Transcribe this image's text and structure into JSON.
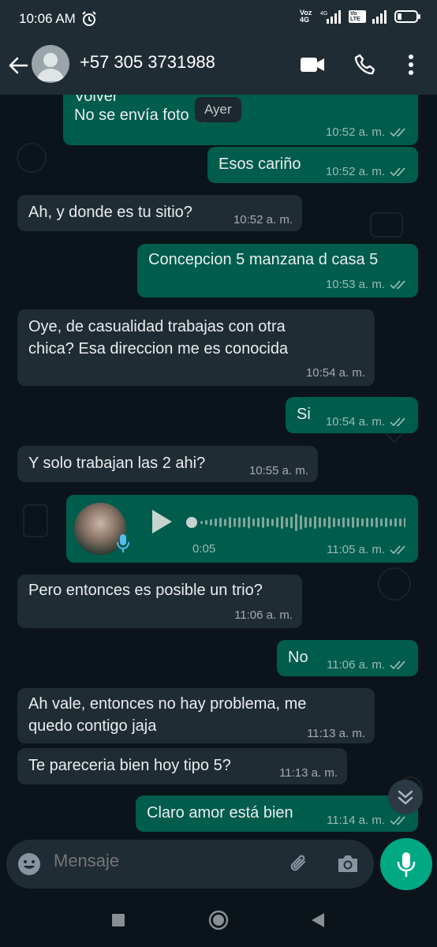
{
  "status": {
    "time": "10:06 AM",
    "net1": "Voz 4G",
    "net2": "4G",
    "volte": "Vo LTE"
  },
  "header": {
    "contact": "+57 305 3731988"
  },
  "date_chip": "Ayer",
  "messages": [
    {
      "dir": "out",
      "lines": [
        "Volver",
        "No se envía foto"
      ],
      "emoji": "😅",
      "time": "10:52 a. m.",
      "read": true
    },
    {
      "dir": "out",
      "lines": [
        "Esos cariño"
      ],
      "time": "10:52 a. m.",
      "read": true
    },
    {
      "dir": "in",
      "lines": [
        "Ah, y donde es tu sitio?"
      ],
      "time": "10:52 a. m."
    },
    {
      "dir": "out",
      "lines": [
        "Concepcion 5 manzana d casa 5"
      ],
      "time": "10:53 a. m.",
      "read": true
    },
    {
      "dir": "in",
      "lines": [
        "Oye, de casualidad trabajas con otra",
        "chica? Esa direccion me es conocida"
      ],
      "time": "10:54 a. m."
    },
    {
      "dir": "out",
      "lines": [
        "Si"
      ],
      "time": "10:54 a. m.",
      "read": true
    },
    {
      "dir": "in",
      "lines": [
        "Y solo trabajan las 2 ahi?"
      ],
      "time": "10:55 a. m."
    },
    {
      "dir": "out",
      "type": "voice",
      "duration": "0:05",
      "time": "11:05 a. m.",
      "read": true
    },
    {
      "dir": "in",
      "lines": [
        "Pero entonces es posible un trio?"
      ],
      "time": "11:06 a. m."
    },
    {
      "dir": "out",
      "lines": [
        "No"
      ],
      "time": "11:06 a. m.",
      "read": true
    },
    {
      "dir": "in",
      "lines": [
        "Ah vale, entonces no hay problema, me",
        "quedo contigo jaja"
      ],
      "time": "11:13 a. m."
    },
    {
      "dir": "in",
      "lines": [
        "Te pareceria bien hoy tipo 5?"
      ],
      "time": "11:13 a. m."
    },
    {
      "dir": "out",
      "lines": [
        "Claro amor está bien"
      ],
      "time": "11:14 a. m.",
      "read": true
    }
  ],
  "input": {
    "placeholder": "Mensaje"
  },
  "colors": {
    "out_bubble": "#005c4b",
    "in_bubble": "#202c33",
    "accent": "#00a884",
    "read_ticks": "#8fb8ad"
  }
}
